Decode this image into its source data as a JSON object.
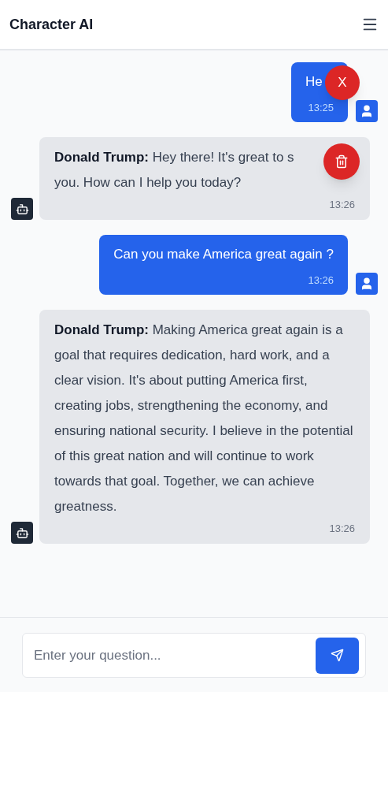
{
  "header": {
    "title": "Character AI"
  },
  "messages": [
    {
      "kind": "user",
      "lines": [
        "He"
      ],
      "time": "13:25",
      "overlay": {
        "kind": "close",
        "text": "X"
      }
    },
    {
      "kind": "bot",
      "speaker": "Donald Trump:",
      "lines": [
        "Hey there! It's great to s",
        "you. How can I help you today?"
      ],
      "time": "13:26",
      "overlay": {
        "kind": "delete"
      }
    },
    {
      "kind": "user",
      "lines": [
        "Can you make America great again ?"
      ],
      "time": "13:26"
    },
    {
      "kind": "bot",
      "speaker": "Donald Trump:",
      "lines": [
        "Making America great again is a goal that requires dedication, hard work, and a clear vision. It's about putting America first, creating jobs, strengthening the economy, and ensuring national security. I believe in the potential of this great nation and will continue to work towards that goal. Together, we can achieve greatness."
      ],
      "time": "13:26"
    }
  ],
  "composer": {
    "placeholder": "Enter your question..."
  }
}
